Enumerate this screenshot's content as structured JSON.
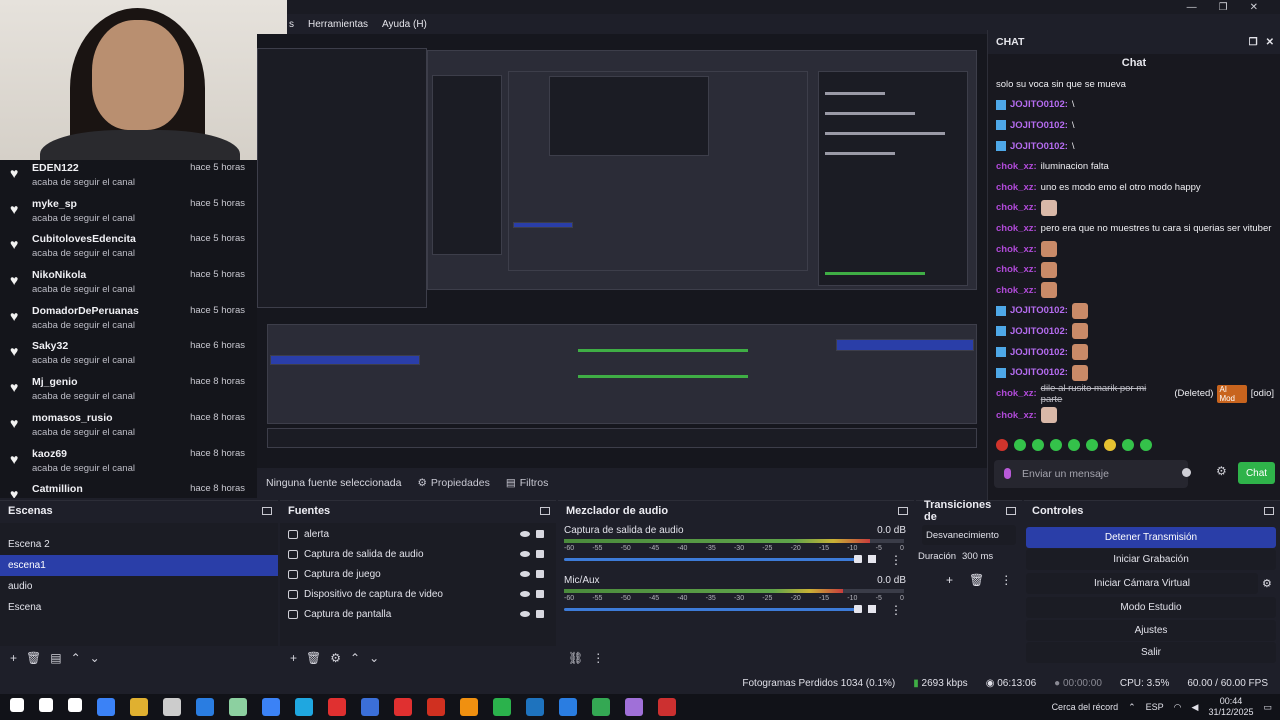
{
  "menu": {
    "items": [
      "s",
      "Herramientas",
      "Ayuda (H)"
    ]
  },
  "window_controls": [
    "—",
    "❐",
    "✕"
  ],
  "followers": [
    {
      "name": "EDEN122",
      "time": "hace 5 horas",
      "sub": "acaba de seguir el canal"
    },
    {
      "name": "myke_sp",
      "time": "hace 5 horas",
      "sub": "acaba de seguir el canal"
    },
    {
      "name": "CubitolovesEdencita",
      "time": "hace 5 horas",
      "sub": "acaba de seguir el canal"
    },
    {
      "name": "NikoNikola",
      "time": "hace 5 horas",
      "sub": "acaba de seguir el canal"
    },
    {
      "name": "DomadorDePeruanas",
      "time": "hace 5 horas",
      "sub": "acaba de seguir el canal"
    },
    {
      "name": "Saky32",
      "time": "hace 6 horas",
      "sub": "acaba de seguir el canal"
    },
    {
      "name": "Mj_genio",
      "time": "hace 8 horas",
      "sub": "acaba de seguir el canal"
    },
    {
      "name": "momasos_rusio",
      "time": "hace 8 horas",
      "sub": "acaba de seguir el canal"
    },
    {
      "name": "kaoz69",
      "time": "hace 8 horas",
      "sub": "acaba de seguir el canal"
    },
    {
      "name": "Catmillion",
      "time": "hace 8 horas",
      "sub": ""
    }
  ],
  "chat": {
    "dock_title": "CHAT",
    "title": "Chat",
    "top_partial": "solo su voca sin que se mueva",
    "messages": [
      {
        "user": "JOJITO0102:",
        "kind": "j",
        "text": "\\",
        "emote": "",
        "badge": true
      },
      {
        "user": "JOJITO0102:",
        "kind": "j",
        "text": "\\",
        "emote": "",
        "badge": true
      },
      {
        "user": "JOJITO0102:",
        "kind": "j",
        "text": "\\",
        "emote": "",
        "badge": true
      },
      {
        "user": "chok_xz:",
        "kind": "c",
        "text": "iluminacion falta",
        "emote": "",
        "badge": false
      },
      {
        "user": "chok_xz:",
        "kind": "c",
        "text": "uno es modo emo el otro modo happy",
        "emote": "",
        "badge": false
      },
      {
        "user": "chok_xz:",
        "kind": "c",
        "text": "",
        "emote": "cat",
        "badge": false
      },
      {
        "user": "chok_xz:",
        "kind": "c",
        "text": "pero era que no muestres tu cara si querias ser vituber",
        "emote": "",
        "badge": false
      },
      {
        "user": "chok_xz:",
        "kind": "c",
        "text": "",
        "emote": "face",
        "badge": false
      },
      {
        "user": "chok_xz:",
        "kind": "c",
        "text": "",
        "emote": "face",
        "badge": false
      },
      {
        "user": "chok_xz:",
        "kind": "c",
        "text": "",
        "emote": "face",
        "badge": false
      },
      {
        "user": "JOJITO0102:",
        "kind": "j",
        "text": "",
        "emote": "face",
        "badge": true
      },
      {
        "user": "JOJITO0102:",
        "kind": "j",
        "text": "",
        "emote": "face",
        "badge": true
      },
      {
        "user": "JOJITO0102:",
        "kind": "j",
        "text": "",
        "emote": "face",
        "badge": true
      },
      {
        "user": "JOJITO0102:",
        "kind": "j",
        "text": "",
        "emote": "face",
        "badge": true
      },
      {
        "user": "chok_xz:",
        "kind": "c",
        "text": "",
        "deleted": "dile al rusito marik por mi parte",
        "deleted_tag": "(Deleted)",
        "mod": "AI Mod",
        "reason": "[odio]",
        "emote": "",
        "badge": false
      },
      {
        "user": "chok_xz:",
        "kind": "c",
        "text": "",
        "emote": "cat",
        "badge": false
      }
    ],
    "input_placeholder": "Enviar un mensaje",
    "send_label": "Chat"
  },
  "source_bar": {
    "selected": "Ninguna fuente seleccionada",
    "properties": "Propiedades",
    "filters": "Filtros"
  },
  "scenes": {
    "title": "Escenas",
    "items": [
      "Escena 2",
      "escena1",
      "audio",
      "Escena"
    ],
    "selected_index": 1
  },
  "sources": {
    "title": "Fuentes",
    "items": [
      "alerta",
      "Captura de salida de audio",
      "Captura de juego",
      "Dispositivo de captura de video",
      "Captura de pantalla"
    ]
  },
  "mixer": {
    "title": "Mezclador de audio",
    "tracks": [
      {
        "name": "Captura de salida de audio",
        "db": "0.0 dB",
        "level": 0.9
      },
      {
        "name": "Mic/Aux",
        "db": "0.0 dB",
        "level": 0.82
      }
    ],
    "ticks": [
      "-60",
      "-55",
      "-50",
      "-45",
      "-40",
      "-35",
      "-30",
      "-25",
      "-20",
      "-15",
      "-10",
      "-5",
      "0"
    ]
  },
  "transitions": {
    "title": "Transiciones de",
    "type": "Desvanecimiento",
    "duration_label": "Duración",
    "duration_value": "300 ms"
  },
  "controls": {
    "title": "Controles",
    "buttons": [
      "Detener Transmisión",
      "Iniciar Grabación",
      "Iniciar Cámara Virtual",
      "Modo Estudio",
      "Ajustes",
      "Salir"
    ]
  },
  "status": {
    "dropped": "Fotogramas Perdidos 1034 (0.1%)",
    "bitrate": "2693 kbps",
    "stream_time": "06:13:06",
    "rec_time": "00:00:00",
    "cpu": "CPU: 3.5%",
    "fps": "60.00 / 60.00 FPS"
  },
  "taskbar": {
    "weather": "Cerca del récord",
    "lang": "ESP",
    "time": "00:44",
    "date": "31/12/2025",
    "icon_colors": [
      "#ffffff",
      "#ffffff",
      "#ffffff",
      "#3b82f6",
      "#e0b030",
      "#cccccc",
      "#2a7de1",
      "#8cd0a0",
      "#3b82f6",
      "#1fa7e0",
      "#e03030",
      "#3b6fd8",
      "#e03030",
      "#d03020",
      "#f09010",
      "#2bb24c",
      "#1e73be",
      "#2a7de1",
      "#34a853",
      "#a070d8",
      "#cc3030"
    ]
  }
}
